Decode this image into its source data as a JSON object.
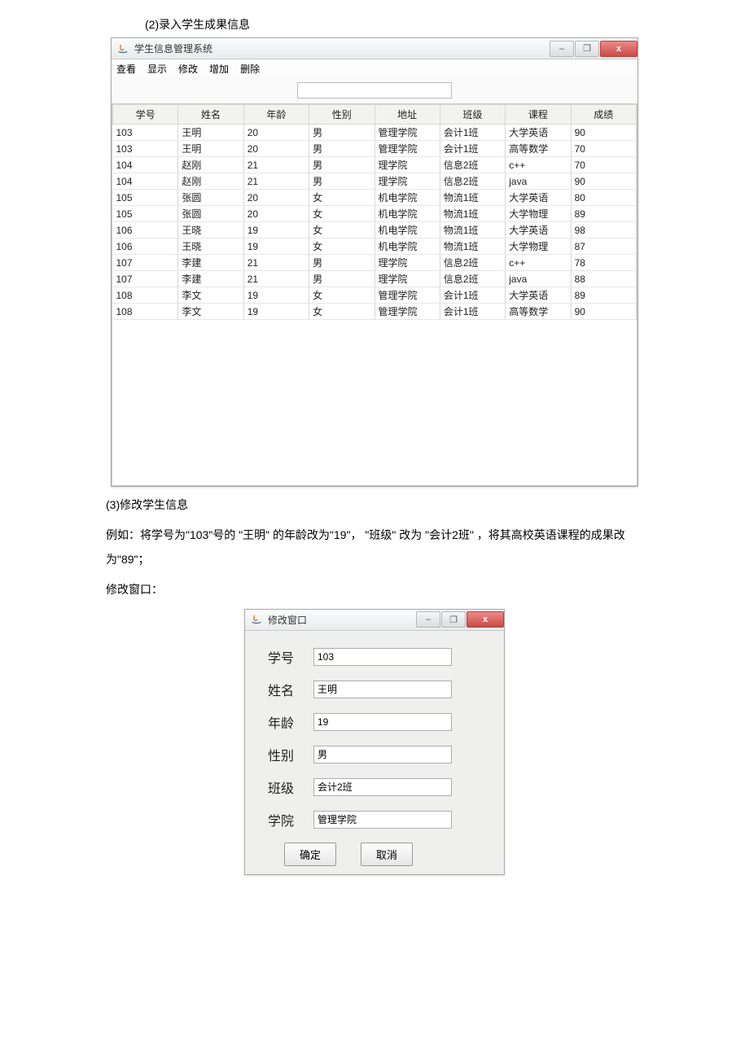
{
  "doc": {
    "section2": "(2)录入学生成果信息",
    "section3_title": "(3)修改学生信息",
    "section3_example": "例如：将学号为\"103\"号的 \"王明\" 的年龄改为\"19\"， \"班级\" 改为 \"会计2班\" ，将其高校英语课程的成果改为\"89\"；",
    "section3_win": "修改窗口："
  },
  "mainWindow": {
    "title": "学生信息管理系统",
    "menus": [
      "查看",
      "显示",
      "修改",
      "增加",
      "删除"
    ],
    "search_value": "",
    "columns": [
      "学号",
      "姓名",
      "年龄",
      "性别",
      "地址",
      "班级",
      "课程",
      "成绩"
    ],
    "rows": [
      [
        "103",
        "王明",
        "20",
        "男",
        "管理学院",
        "会计1班",
        "大学英语",
        "90"
      ],
      [
        "103",
        "王明",
        "20",
        "男",
        "管理学院",
        "会计1班",
        "高等数学",
        "70"
      ],
      [
        "104",
        "赵刚",
        "21",
        "男",
        "理学院",
        "信息2班",
        "c++",
        "70"
      ],
      [
        "104",
        "赵刚",
        "21",
        "男",
        "理学院",
        "信息2班",
        "java",
        "90"
      ],
      [
        "105",
        "张圆",
        "20",
        "女",
        "机电学院",
        "物流1班",
        "大学英语",
        "80"
      ],
      [
        "105",
        "张圆",
        "20",
        "女",
        "机电学院",
        "物流1班",
        "大学物理",
        "89"
      ],
      [
        "106",
        "王晓",
        "19",
        "女",
        "机电学院",
        "物流1班",
        "大学英语",
        "98"
      ],
      [
        "106",
        "王晓",
        "19",
        "女",
        "机电学院",
        "物流1班",
        "大学物理",
        "87"
      ],
      [
        "107",
        "李建",
        "21",
        "男",
        "理学院",
        "信息2班",
        "c++",
        "78"
      ],
      [
        "107",
        "李建",
        "21",
        "男",
        "理学院",
        "信息2班",
        "java",
        "88"
      ],
      [
        "108",
        "李文",
        "19",
        "女",
        "管理学院",
        "会计1班",
        "大学英语",
        "89"
      ],
      [
        "108",
        "李文",
        "19",
        "女",
        "管理学院",
        "会计1班",
        "高等数学",
        "90"
      ]
    ]
  },
  "editWindow": {
    "title": "修改窗口",
    "fields": {
      "id": {
        "label": "学号",
        "value": "103"
      },
      "name": {
        "label": "姓名",
        "value": "王明"
      },
      "age": {
        "label": "年龄",
        "value": "19"
      },
      "gender": {
        "label": "性别",
        "value": "男"
      },
      "class": {
        "label": "班级",
        "value": "会计2班"
      },
      "college": {
        "label": "学院",
        "value": "管理学院"
      }
    },
    "buttons": {
      "ok": "确定",
      "cancel": "取消"
    }
  },
  "winButtons": {
    "min": "–",
    "max": "❐",
    "close": "x"
  }
}
